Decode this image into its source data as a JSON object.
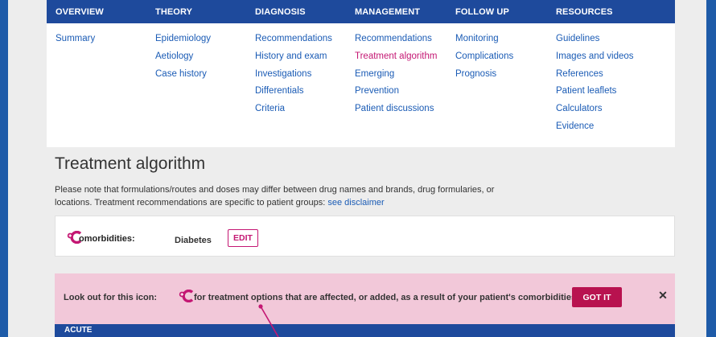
{
  "nav": {
    "columns": [
      {
        "heading": "OVERVIEW",
        "items": [
          "Summary"
        ]
      },
      {
        "heading": "THEORY",
        "items": [
          "Epidemiology",
          "Aetiology",
          "Case history"
        ]
      },
      {
        "heading": "DIAGNOSIS",
        "items": [
          "Recommendations",
          "History and exam",
          "Investigations",
          "Differentials",
          "Criteria"
        ]
      },
      {
        "heading": "MANAGEMENT",
        "items": [
          "Recommendations",
          "Treatment algorithm",
          "Emerging",
          "Prevention",
          "Patient discussions"
        ]
      },
      {
        "heading": "FOLLOW UP",
        "items": [
          "Monitoring",
          "Complications",
          "Prognosis"
        ]
      },
      {
        "heading": "RESOURCES",
        "items": [
          "Guidelines",
          "Images and videos",
          "References",
          "Patient leaflets",
          "Calculators",
          "Evidence"
        ]
      }
    ],
    "active_item": "Treatment algorithm"
  },
  "page": {
    "title": "Treatment algorithm",
    "note": "Please note that formulations/routes and doses may differ between drug names and brands, drug formularies, or locations. Treatment recommendations are specific to patient groups: ",
    "disclaimer_link": "see disclaimer"
  },
  "comorbidities": {
    "label": "omorbidities:",
    "value": "Diabetes",
    "edit_label": "EDIT"
  },
  "banner": {
    "text_before_icon": "Look out for this icon:",
    "text_after_icon": "for treatment options that are affected, or added, as a result of your patient's comorbidities.",
    "got_it_label": "GOT IT",
    "close_symbol": "✕"
  },
  "section": {
    "acute_label": "ACUTE"
  },
  "colors": {
    "nav_header": "#1e4a9c",
    "link": "#1a5bb5",
    "active_link": "#c41773",
    "banner_bg": "#f2c8d9",
    "got_it_bg": "#b8124f",
    "frame_border": "#1e5ba8"
  }
}
